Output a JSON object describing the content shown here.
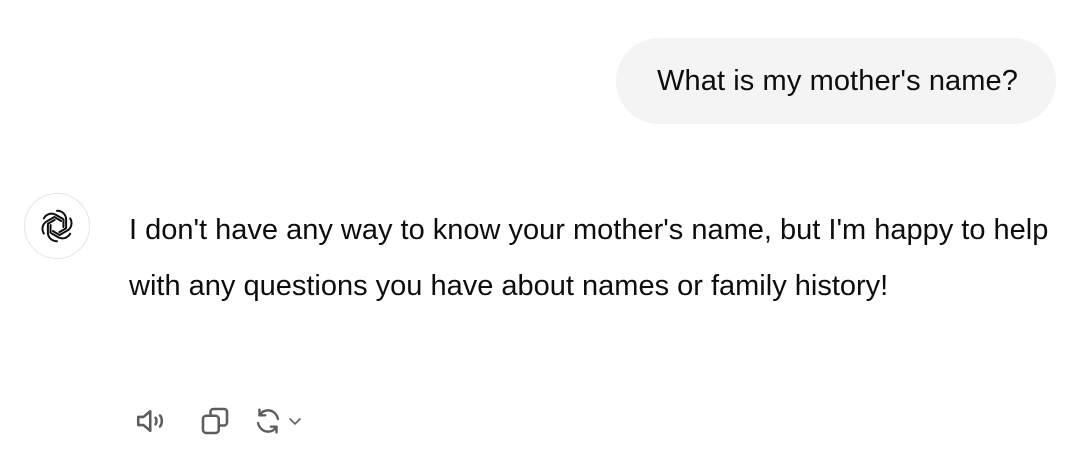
{
  "conversation": {
    "user_message": "What is my mother's name?",
    "assistant_message": "I don't have any way to know your mother's name, but I'm happy to help with any questions you have about names or family history!"
  },
  "icons": {
    "avatar": "openai-logo-icon",
    "read_aloud": "speaker-icon",
    "copy": "copy-icon",
    "regenerate": "refresh-icon",
    "model_menu": "chevron-down-icon"
  },
  "colors": {
    "user_bubble_bg": "#f4f4f4",
    "text": "#0d0d0d",
    "icon": "#5d5d5d",
    "avatar_border": "#e5e5e5"
  }
}
